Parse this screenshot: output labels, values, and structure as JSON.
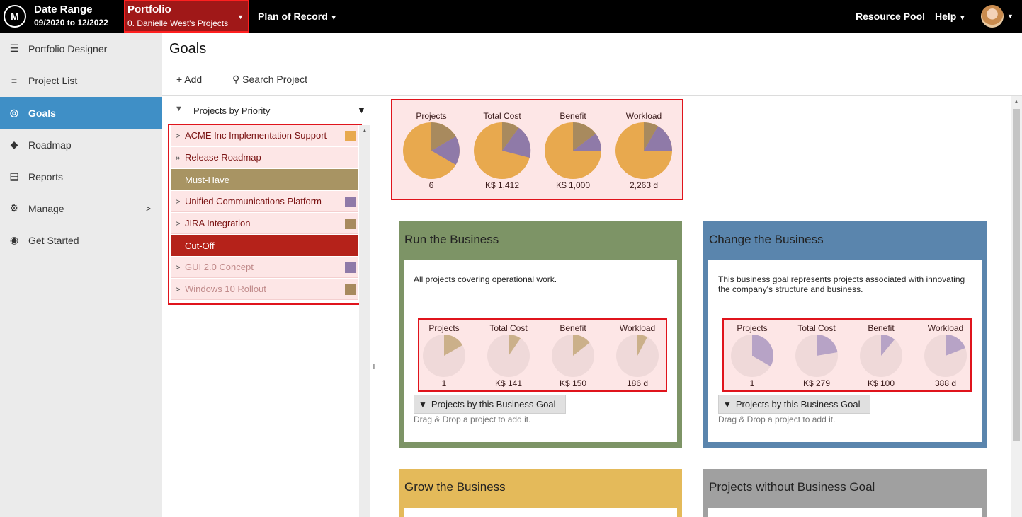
{
  "topbar": {
    "logo_text": "M",
    "date_range_label": "Date Range",
    "date_range_value": "09/2020 to 12/2022",
    "portfolio_label": "Portfolio",
    "portfolio_value": "0. Danielle West's Projects",
    "plan_label": "Plan of Record",
    "resource_pool": "Resource Pool",
    "help": "Help"
  },
  "sidebar": {
    "items": [
      {
        "label": "Portfolio Designer",
        "icon": "portfolio-designer-icon"
      },
      {
        "label": "Project List",
        "icon": "list-icon"
      },
      {
        "label": "Goals",
        "icon": "target-icon",
        "active": true
      },
      {
        "label": "Roadmap",
        "icon": "roadmap-icon"
      },
      {
        "label": "Reports",
        "icon": "report-icon"
      },
      {
        "label": "Manage",
        "icon": "gear-icon",
        "has_submenu": true
      },
      {
        "label": "Get Started",
        "icon": "compass-icon"
      }
    ]
  },
  "main": {
    "title": "Goals",
    "add_label": "Add",
    "search_label": "Search Project"
  },
  "priority_list": {
    "header": "Projects by Priority",
    "rows": [
      {
        "label": "ACME Inc Implementation Support",
        "swatch": "#e8a94e"
      },
      {
        "label": "Release Roadmap",
        "swatch": ""
      },
      {
        "label": "Must-Have",
        "band_color": "#a89463"
      },
      {
        "label": "Unified Communications Platform",
        "swatch": "#8f7aa8"
      },
      {
        "label": "JIRA Integration",
        "swatch": "#a88a5e"
      },
      {
        "label": "Cut-Off",
        "band_color": "#b5221a"
      },
      {
        "label": "GUI 2.0 Concept",
        "swatch": "#8f7aa8"
      },
      {
        "label": "Windows 10 Rollout",
        "swatch": "#a88a5e"
      }
    ]
  },
  "summary": {
    "metrics": [
      {
        "label": "Projects",
        "value": "6"
      },
      {
        "label": "Total Cost",
        "value": "K$ 1,412"
      },
      {
        "label": "Benefit",
        "value": "K$ 1,000"
      },
      {
        "label": "Workload",
        "value": "2,263 d"
      }
    ]
  },
  "goals": [
    {
      "title": "Run the Business",
      "frame_color": "#7d9466",
      "description": "All projects covering operational work.",
      "metrics": [
        {
          "label": "Projects",
          "value": "1"
        },
        {
          "label": "Total Cost",
          "value": "K$ 141"
        },
        {
          "label": "Benefit",
          "value": "K$ 150"
        },
        {
          "label": "Workload",
          "value": "186 d"
        }
      ],
      "button": "Projects by this Business Goal",
      "dnd": "Drag & Drop a project to add it."
    },
    {
      "title": "Change the Business",
      "frame_color": "#5a85ad",
      "description": "This business goal represents projects associated with innovating the company's structure and business.",
      "metrics": [
        {
          "label": "Projects",
          "value": "1"
        },
        {
          "label": "Total Cost",
          "value": "K$ 279"
        },
        {
          "label": "Benefit",
          "value": "K$ 100"
        },
        {
          "label": "Workload",
          "value": "388 d"
        }
      ],
      "button": "Projects by this Business Goal",
      "dnd": "Drag & Drop a project to add it."
    },
    {
      "title": "Grow the Business",
      "frame_color": "#e4ba5a"
    },
    {
      "title": "Projects without Business Goal",
      "frame_color": "#a0a0a0"
    }
  ]
}
